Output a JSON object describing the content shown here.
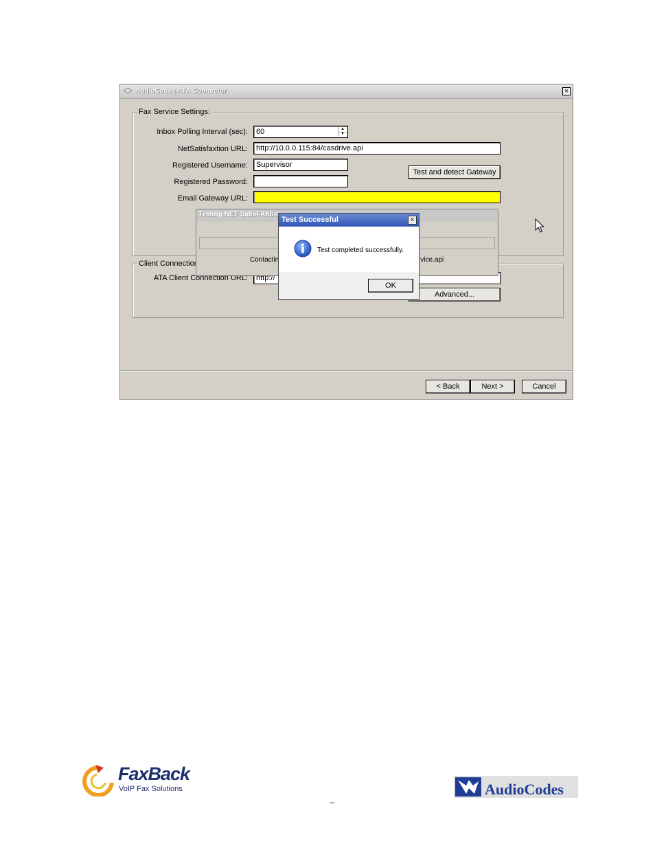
{
  "window": {
    "title": "AudioCodes ATA Connector",
    "close_glyph": "×"
  },
  "fax_group": {
    "legend": "Fax Service Settings:",
    "polling_label": "Inbox Polling Interval (sec):",
    "polling_value": "60",
    "url_label": "NetSatisfaxtion URL:",
    "url_value": "http://10.0.0.115:84/casdrive.api",
    "username_label": "Registered Username:",
    "username_value": "Supervisor",
    "password_label": "Registered Password:",
    "password_value": "",
    "email_label": "Email Gateway URL:",
    "email_value": "",
    "test_button": "Test and detect Gateway"
  },
  "client_group": {
    "legend": "Client Connection",
    "url_label": "ATA Client Connection URL:",
    "url_value": "http://",
    "advanced_button": "Advanced..."
  },
  "progress_dialog": {
    "title": "Testing NET SatisFAXtion",
    "text_left": "Contacting",
    "text_right": "rvice.api"
  },
  "message_box": {
    "title": "Test Successful",
    "close_glyph": "×",
    "message": "Test completed successfully.",
    "ok_button": "OK",
    "icon": "info-icon"
  },
  "nav": {
    "back": "< Back",
    "next": "Next >",
    "cancel": "Cancel"
  },
  "footer": {
    "faxback_name": "FaxBack",
    "faxback_tagline": "VoIP Fax Solutions",
    "audiocodes_name": "AudioCodes",
    "page_mark": "–"
  },
  "colors": {
    "highlight_field": "#ffff00",
    "msgbox_title": "#2f55b3",
    "faxback_orange": "#f0a020",
    "brand_blue": "#1d2f6e"
  }
}
